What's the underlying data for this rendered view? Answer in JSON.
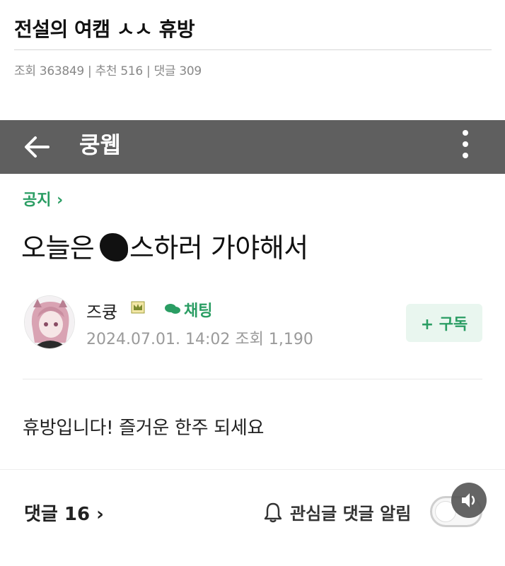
{
  "outer": {
    "title": "전설의 여캠 ㅅㅅ 휴방",
    "views_label": "조회",
    "views": "363849",
    "likes_label": "추천",
    "likes": "516",
    "comments_label": "댓글",
    "comments": "309",
    "separator": "|"
  },
  "app": {
    "title": "쿵웹",
    "back_icon": "arrow-left-icon",
    "more_icon": "vertical-ellipsis-icon",
    "bar_color": "#5f5f5f"
  },
  "post": {
    "notice_link": "공지 ›",
    "title_before": "오늘은 ",
    "title_after": "스하러 가야해서",
    "author": "즈큥",
    "chat_label": "채팅",
    "date": "2024.07.01. 14:02",
    "views_label": "조회",
    "views": "1,190",
    "subscribe_label": "+ 구독",
    "body": "휴방입니다! 즐거운 한주 되세요",
    "accent_color": "#2a9d63"
  },
  "footer": {
    "comments_link": "댓글 16 ›",
    "notify_label": "관심글 댓글 알림",
    "toggle_on": false
  }
}
